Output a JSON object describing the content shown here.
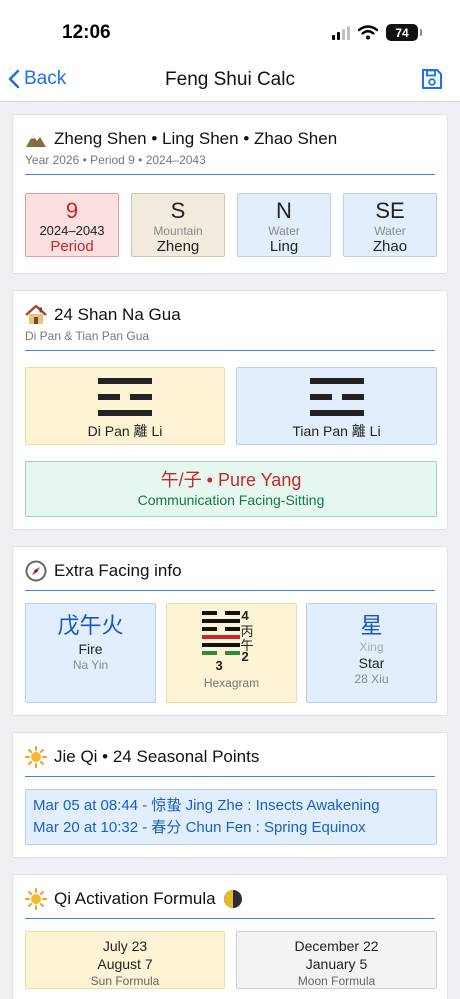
{
  "status_bar": {
    "time": "12:06",
    "battery": "74"
  },
  "nav": {
    "back_label": "Back",
    "title": "Feng Shui Calc"
  },
  "zheng_shen": {
    "title": "Zheng Shen • Ling Shen • Zhao Shen",
    "subtitle": "Year 2026 • Period 9 • 2024–2043",
    "period": {
      "value": "9",
      "range": "2024–2043",
      "label": "Period"
    },
    "tiles": [
      {
        "dir": "S",
        "kind": "Mountain",
        "name": "Zheng"
      },
      {
        "dir": "N",
        "kind": "Water",
        "name": "Ling"
      },
      {
        "dir": "SE",
        "kind": "Water",
        "name": "Zhao"
      }
    ]
  },
  "shan_na_gua": {
    "title": "24 Shan Na Gua",
    "subtitle": "Di Pan & Tian Pan Gua",
    "di_pan_label": "Di Pan 離 Li",
    "tian_pan_label": "Tian Pan 離 Li",
    "relation_title": "午/子 • Pure Yang",
    "relation_sub": "Communication Facing-Sitting"
  },
  "extra_facing": {
    "title": "Extra Facing info",
    "na_yin": {
      "chinese": "戊午火",
      "element": "Fire",
      "label": "Na Yin"
    },
    "hexagram": {
      "numbers": [
        "4",
        "2",
        "3"
      ],
      "chars": [
        "丙",
        "午"
      ],
      "label": "Hexagram"
    },
    "xiu": {
      "chinese": "星",
      "pinyin": "Xing",
      "english": "Star",
      "label": "28 Xiu"
    }
  },
  "jie_qi": {
    "title": "Jie Qi • 24 Seasonal Points",
    "lines": [
      "Mar 05 at 08:44 - 惊蛰 Jing Zhe : Insects Awakening",
      "Mar 20 at 10:32 - 春分 Chun Fen : Spring Equinox"
    ]
  },
  "qi_activation": {
    "title": "Qi Activation Formula",
    "sun": {
      "date1": "July 23",
      "date2": "August 7",
      "label": "Sun Formula"
    },
    "moon": {
      "date1": "December 22",
      "date2": "January 5",
      "label": "Moon Formula"
    }
  },
  "colors": {
    "accent": "#1a73e8",
    "rule_blue": "#3b82f6",
    "period_red": "#c62828",
    "na_yin_blue": "#1556c0",
    "relation_green": "#137a48"
  },
  "icons": [
    "chevron-left-icon",
    "floppy-save-icon",
    "mountain-icon",
    "house-icon",
    "compass-icon",
    "sun-icon",
    "sun-small-icon",
    "half-moon-icon",
    "signal-icon",
    "wifi-icon",
    "battery-icon"
  ]
}
